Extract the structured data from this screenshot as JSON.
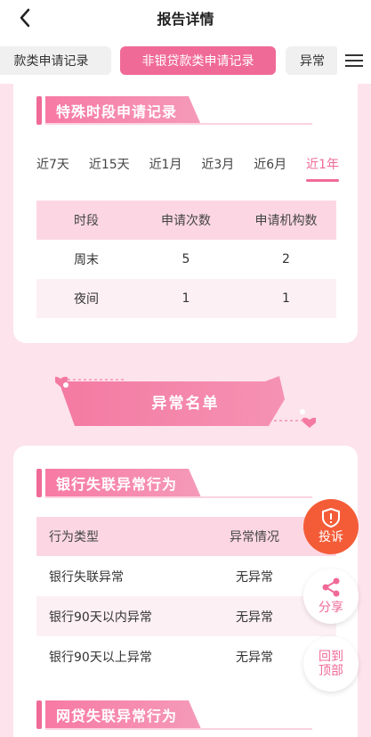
{
  "header": {
    "title": "报告详情"
  },
  "tabs": [
    {
      "label": "款类申请记录"
    },
    {
      "label": "非银贷款类申请记录"
    },
    {
      "label": "异常"
    }
  ],
  "special_period": {
    "title": "特殊时段申请记录",
    "periods": [
      "近7天",
      "近15天",
      "近1月",
      "近3月",
      "近6月",
      "近1年"
    ],
    "active_period": "近1年",
    "columns": [
      "时段",
      "申请次数",
      "申请机构数"
    ],
    "rows": [
      [
        "周末",
        "5",
        "2"
      ],
      [
        "夜间",
        "1",
        "1"
      ]
    ]
  },
  "banner": {
    "label": "异常名单"
  },
  "bank_lost": {
    "title": "银行失联异常行为",
    "columns": [
      "行为类型",
      "异常情况"
    ],
    "rows": [
      [
        "银行失联异常",
        "无异常"
      ],
      [
        "银行90天以内异常",
        "无异常"
      ],
      [
        "银行90天以上异常",
        "无异常"
      ]
    ]
  },
  "online_lost": {
    "title": "网贷失联异常行为"
  },
  "fab": {
    "complain": "投诉",
    "share": "分享",
    "back_top_1": "回到",
    "back_top_2": "顶部"
  },
  "colors": {
    "accent": "#f06a98",
    "complain": "#f45c38",
    "page_bg": "#fde3ec"
  }
}
